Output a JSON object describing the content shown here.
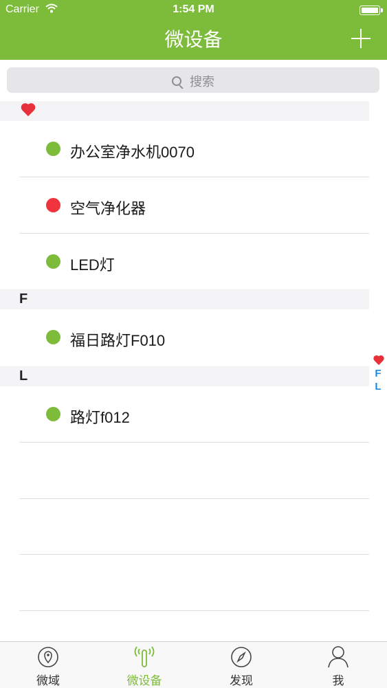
{
  "status_bar": {
    "carrier": "Carrier",
    "time": "1:54 PM"
  },
  "nav": {
    "title": "微设备"
  },
  "search": {
    "placeholder": "搜索"
  },
  "sections": [
    {
      "header": "favorites-heart",
      "items": [
        {
          "name": "办公室净水机0070",
          "status_color": "#7dbb3a"
        },
        {
          "name": "空气净化器",
          "status_color": "#f0343d"
        },
        {
          "name": "LED灯",
          "status_color": "#7dbb3a"
        }
      ]
    },
    {
      "header": "F",
      "items": [
        {
          "name": "福日路灯F010",
          "status_color": "#7dbb3a"
        }
      ]
    },
    {
      "header": "L",
      "items": [
        {
          "name": "路灯f012",
          "status_color": "#7dbb3a"
        }
      ]
    }
  ],
  "index": {
    "letters": [
      "F",
      "L"
    ]
  },
  "tabs": [
    {
      "label": "微域",
      "icon": "location-pin-icon"
    },
    {
      "label": "微设备",
      "icon": "device-signal-icon",
      "active": true
    },
    {
      "label": "发现",
      "icon": "compass-icon"
    },
    {
      "label": "我",
      "icon": "person-icon"
    }
  ],
  "colors": {
    "accent": "#7dbb3a",
    "offline": "#f0343d",
    "index": "#1a8ae5"
  }
}
